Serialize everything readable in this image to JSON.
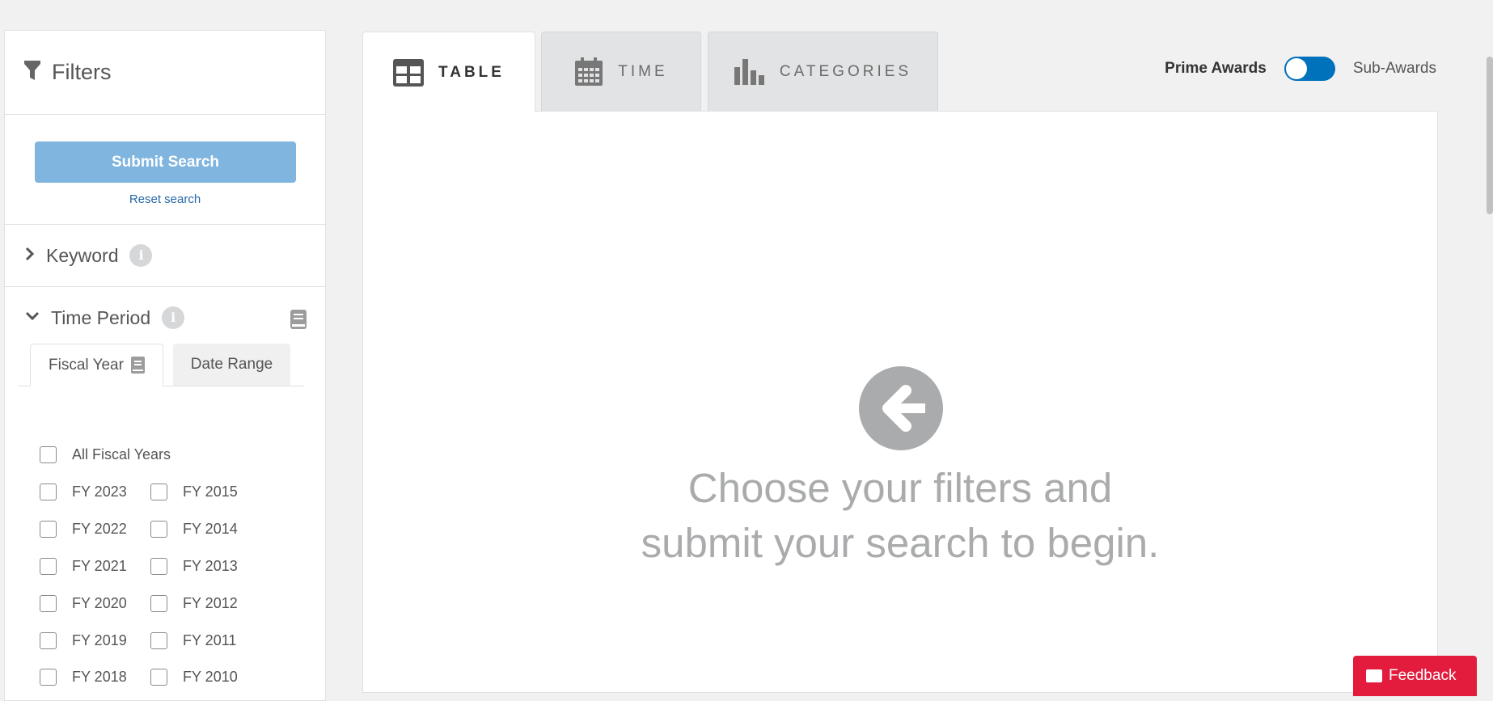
{
  "sidebar": {
    "title": "Filters",
    "submit_label": "Submit Search",
    "reset_label": "Reset search",
    "keyword_label": "Keyword",
    "time_period_label": "Time Period",
    "info_glyph": "i",
    "subtabs": {
      "fiscal_year": "Fiscal Year",
      "date_range": "Date Range"
    },
    "all_fiscal_years": "All Fiscal Years",
    "fiscal_years_left": [
      "FY 2023",
      "FY 2022",
      "FY 2021",
      "FY 2020",
      "FY 2019",
      "FY 2018"
    ],
    "fiscal_years_right": [
      "FY 2015",
      "FY 2014",
      "FY 2013",
      "FY 2012",
      "FY 2011",
      "FY 2010"
    ]
  },
  "tabs": [
    {
      "label": "TABLE",
      "icon": "table-icon",
      "active": true
    },
    {
      "label": "TIME",
      "icon": "calendar-icon",
      "active": false
    },
    {
      "label": "CATEGORIES",
      "icon": "bar-chart-icon",
      "active": false
    }
  ],
  "awards_toggle": {
    "left_label": "Prime Awards",
    "right_label": "Sub-Awards"
  },
  "empty_state": {
    "line1": "Choose your filters and",
    "line2": "submit your search to begin.",
    "icon": "arrow-left-circle-icon"
  },
  "feedback_label": "Feedback",
  "colors": {
    "accent": "#0071bb",
    "submit": "#7fb5de",
    "feedback": "#e31c3d",
    "muted": "#aaabad"
  }
}
